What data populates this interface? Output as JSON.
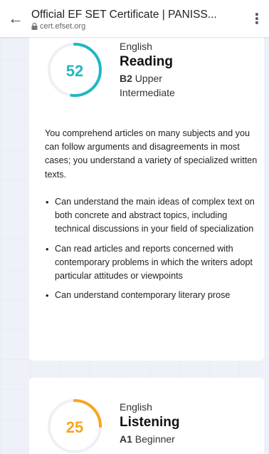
{
  "browser": {
    "page_title": "Official EF SET Certificate | PANISS...",
    "url": "cert.efset.org"
  },
  "colors": {
    "reading_accent": "#1fb8c4",
    "listening_accent": "#f5a623",
    "ring_track": "#eef0f3"
  },
  "reading": {
    "score": "52",
    "score_fraction": 0.52,
    "language": "English",
    "skill": "Reading",
    "level_code": "B2",
    "level_name_1": "Upper",
    "level_name_2": "Intermediate",
    "description": "You comprehend articles on many subjects and you can follow arguments and disagreements in most cases; you understand a variety of specialized written texts.",
    "bullets": [
      "Can understand the main ideas of complex text on both concrete and abstract topics, including technical discussions in your field of specialization",
      "Can read articles and reports concerned with contemporary problems in which the writers adopt particular attitudes or viewpoints",
      "Can understand contemporary literary prose"
    ]
  },
  "listening": {
    "score": "25",
    "score_fraction": 0.25,
    "language": "English",
    "skill": "Listening",
    "level_code": "A1",
    "level_name": "Beginner"
  }
}
